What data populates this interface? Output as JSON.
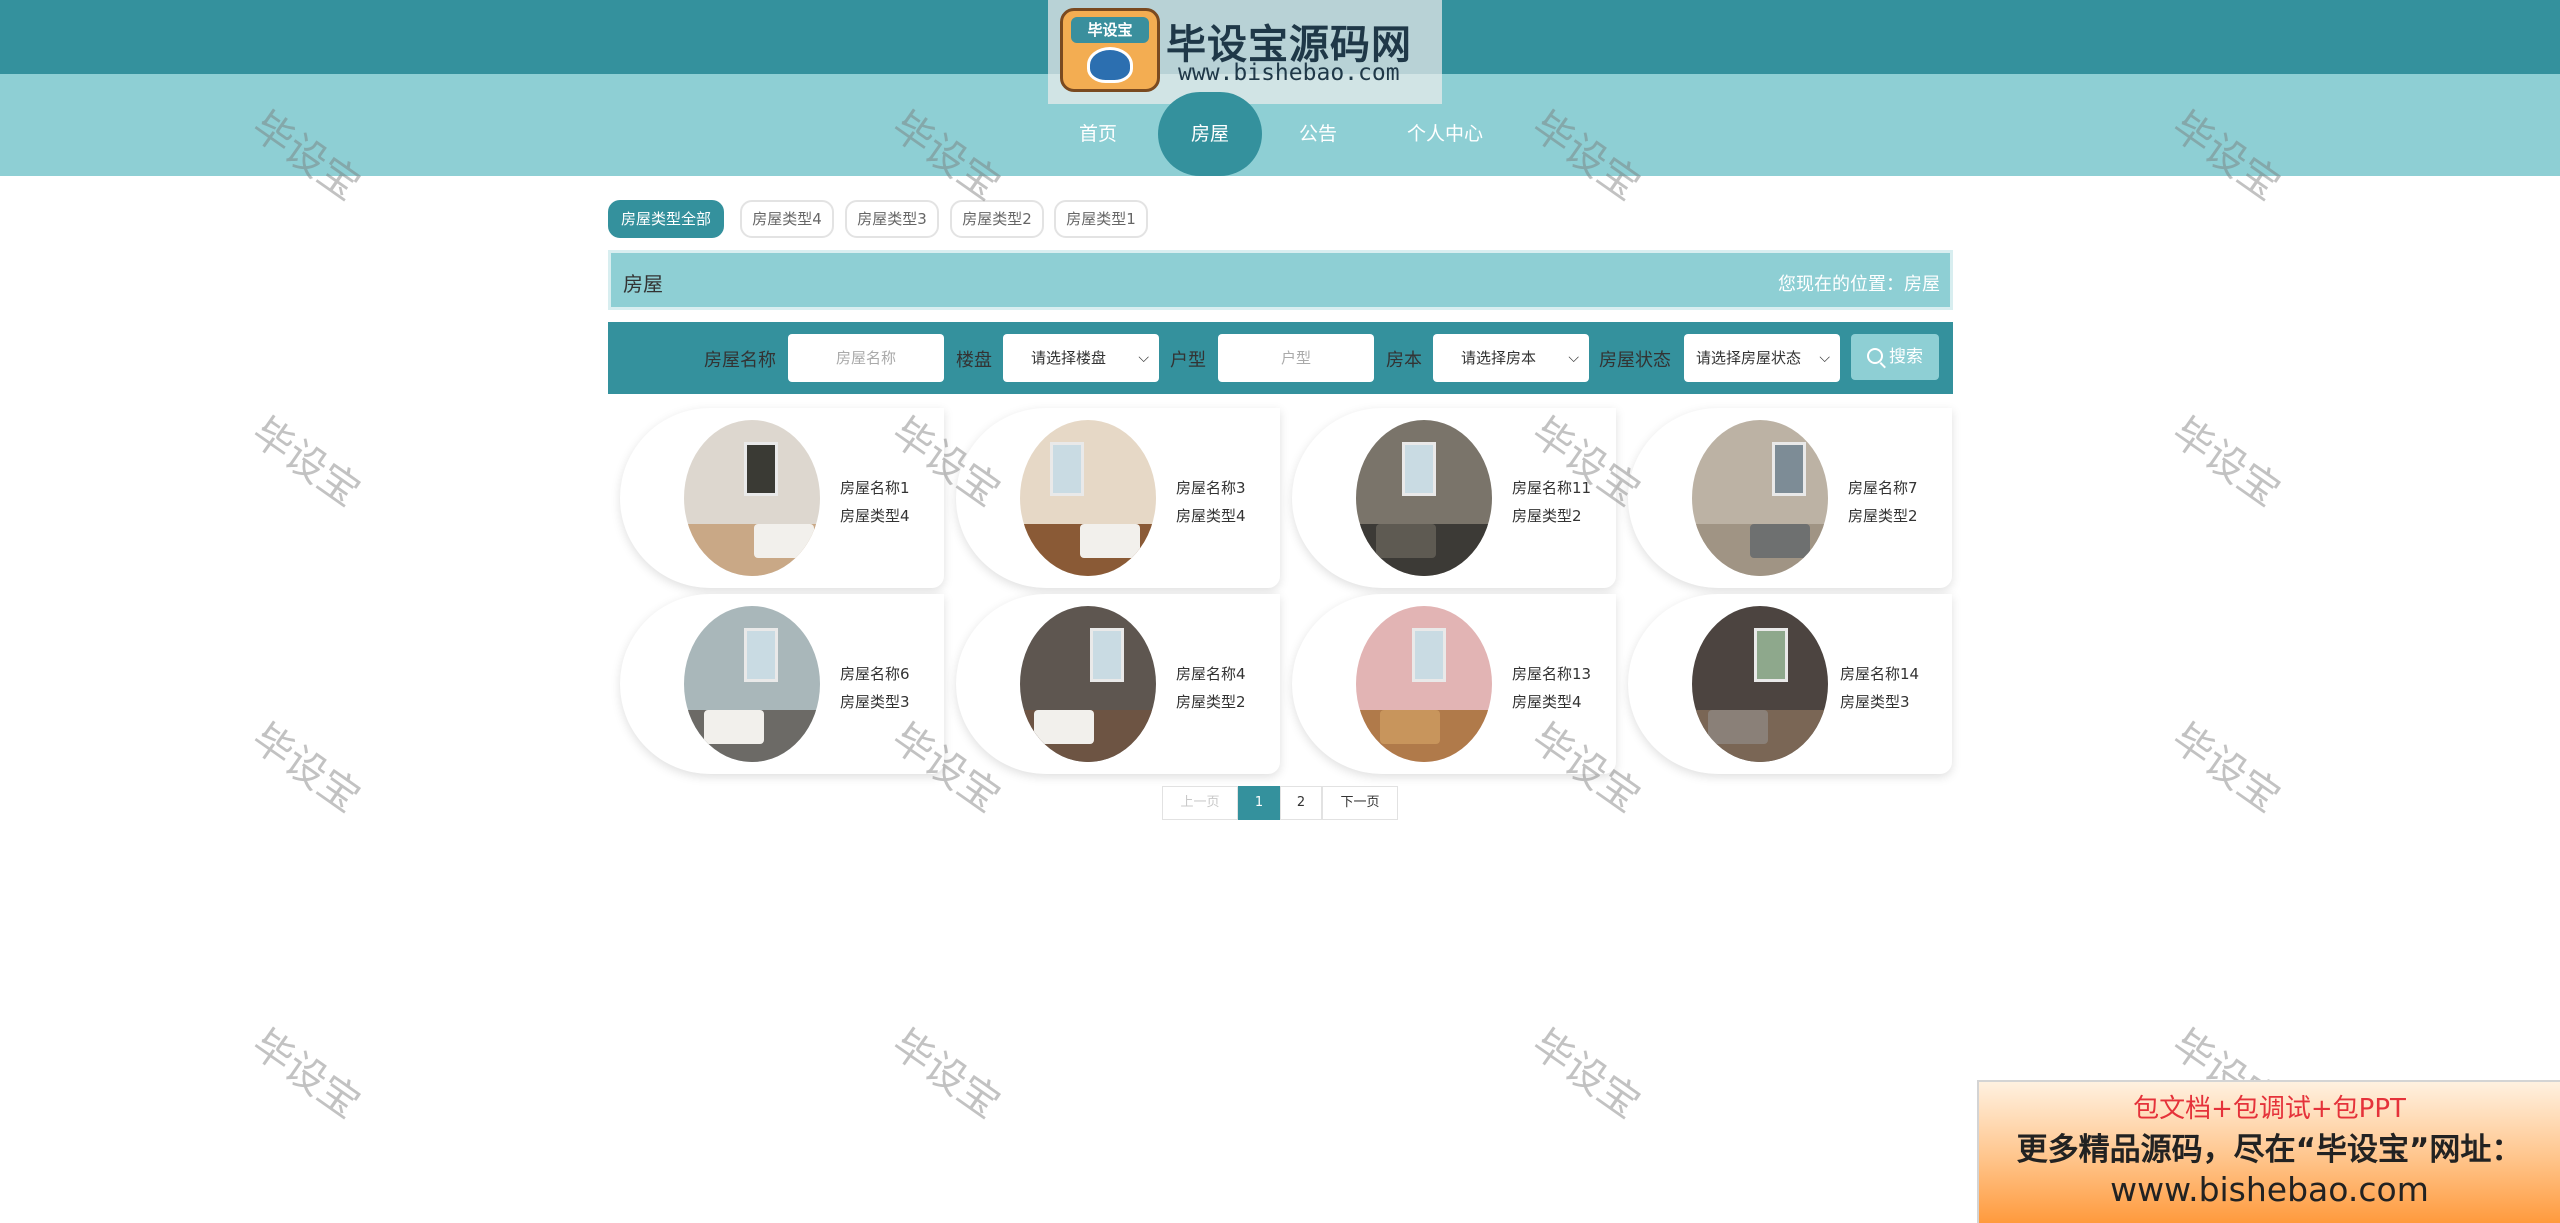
{
  "logo": {
    "emblem_text": "毕设宝",
    "title": "毕设宝源码网",
    "url": "www.bishebao.com"
  },
  "nav": {
    "items": [
      {
        "label": "首页"
      },
      {
        "label": "房屋",
        "active": true
      },
      {
        "label": "公告"
      },
      {
        "label": "个人中心"
      }
    ]
  },
  "categories": {
    "items": [
      {
        "label": "房屋类型全部",
        "active": true
      },
      {
        "label": "房屋类型4"
      },
      {
        "label": "房屋类型3"
      },
      {
        "label": "房屋类型2"
      },
      {
        "label": "房屋类型1"
      }
    ]
  },
  "title_bar": {
    "title": "房屋",
    "crumb": "您现在的位置：房屋"
  },
  "search": {
    "name_label": "房屋名称",
    "name_placeholder": "房屋名称",
    "estate_label": "楼盘",
    "estate_value": "请选择楼盘",
    "layout_label": "户型",
    "layout_placeholder": "户型",
    "book_label": "房本",
    "book_value": "请选择房本",
    "status_label": "房屋状态",
    "status_value": "请选择房屋状态",
    "button_label": "搜索"
  },
  "listings": [
    {
      "name": "房屋名称1",
      "type": "房屋类型4"
    },
    {
      "name": "房屋名称3",
      "type": "房屋类型4"
    },
    {
      "name": "房屋名称11",
      "type": "房屋类型2"
    },
    {
      "name": "房屋名称7",
      "type": "房屋类型2"
    },
    {
      "name": "房屋名称6",
      "type": "房屋类型3"
    },
    {
      "name": "房屋名称4",
      "type": "房屋类型2"
    },
    {
      "name": "房屋名称13",
      "type": "房屋类型4"
    },
    {
      "name": "房屋名称14",
      "type": "房屋类型3"
    }
  ],
  "pagination": {
    "prev_label": "上一页",
    "pages": [
      "1",
      "2"
    ],
    "current": "1",
    "next_label": "下一页"
  },
  "watermark": {
    "text": "毕设宝"
  },
  "promo": {
    "line1": "包文档+包调试+包PPT",
    "line2": "更多精品源码，尽在“毕设宝”网址：",
    "line3": "www.bishebao.com"
  },
  "colors": {
    "primary": "#34919d",
    "light": "#8ecfd4"
  }
}
